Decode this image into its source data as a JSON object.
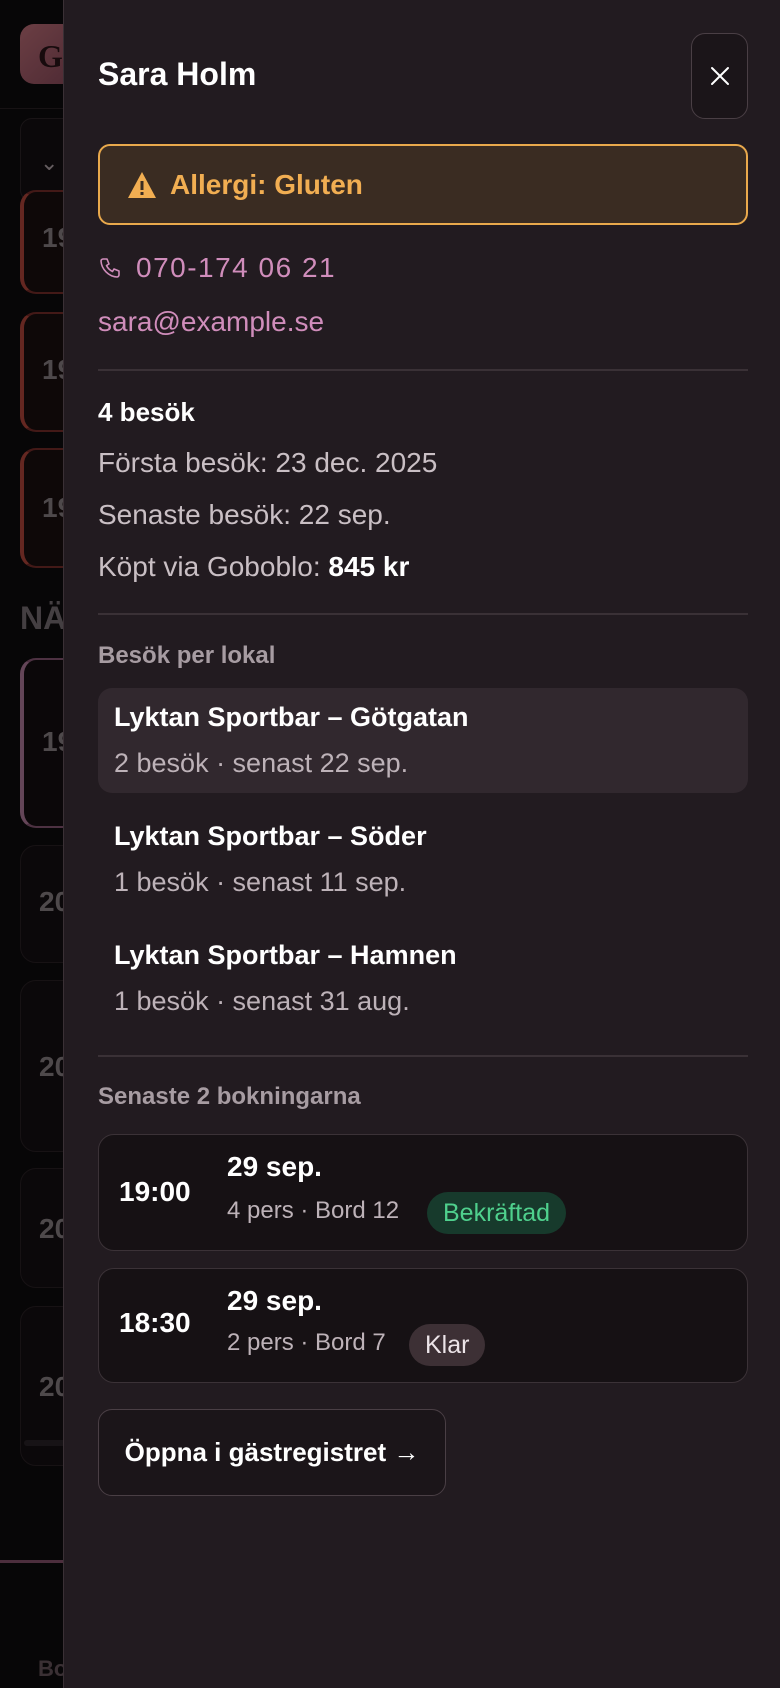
{
  "background": {
    "logo_letter": "G",
    "card_labels": [
      "19",
      "19",
      "19",
      "19",
      "20",
      "20",
      "20",
      "20"
    ],
    "section_label": "NÄ",
    "footer_label": "Bo"
  },
  "drawer": {
    "guest_name": "Sara Holm",
    "close_icon": "close-icon",
    "allergy": {
      "icon": "warning-icon",
      "text": "Allergi: Gluten",
      "color": "#f1ae52"
    },
    "phone": {
      "icon": "phone-icon",
      "value": "070-174 06 21"
    },
    "email": "sara@example.se",
    "stats": {
      "visits": "4 besök",
      "first_visit": "Första besök: 23 dec. 2025",
      "last_visit": "Senaste besök: 22 sep.",
      "purchased_label": "Köpt via Goboblo: ",
      "purchased_value": "845 kr"
    },
    "venues_title": "Besök per lokal",
    "venues": [
      {
        "name": "Lyktan Sportbar – Götgatan",
        "meta": "2 besök · senast 22 sep."
      },
      {
        "name": "Lyktan Sportbar – Söder",
        "meta": "1 besök · senast 11 sep."
      },
      {
        "name": "Lyktan Sportbar – Hamnen",
        "meta": "1 besök · senast 31 aug."
      }
    ],
    "bookings_title": "Senaste 2 bokningarna",
    "bookings": [
      {
        "time": "19:00",
        "date": "29 sep.",
        "meta": "4 pers · Bord 12",
        "status": "Bekräftad",
        "status_color": "#4fd08d"
      },
      {
        "time": "18:30",
        "date": "29 sep.",
        "meta": "2 pers · Bord 7",
        "status": "Klar",
        "status_color": "#ece4e8"
      }
    ],
    "open_register_label": "Öppna i gästregistret →"
  }
}
